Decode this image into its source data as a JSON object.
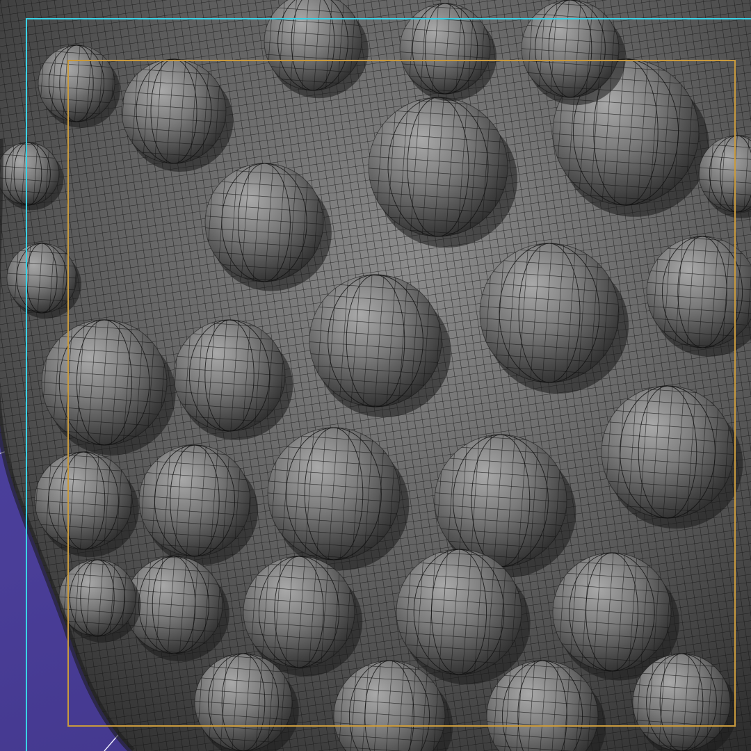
{
  "viewport": {
    "background": "#4a3f9a",
    "mesh_color": "#6f6f6f",
    "wire_color": "#101010",
    "outer_frame_color": "#39d2e6",
    "inner_frame_color": "#c99a3d",
    "object": "blob-mesh-icon"
  }
}
